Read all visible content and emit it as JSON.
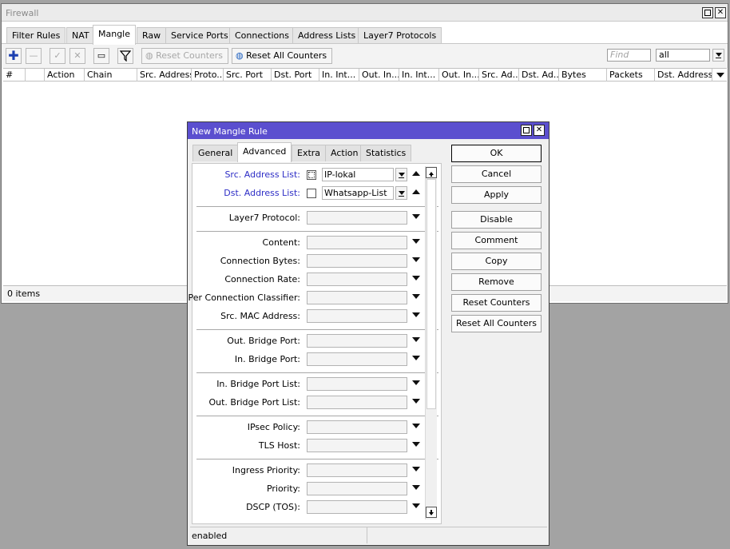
{
  "firewall": {
    "title": "Firewall",
    "tabs": [
      "Filter Rules",
      "NAT",
      "Mangle",
      "Raw",
      "Service Ports",
      "Connections",
      "Address Lists",
      "Layer7 Protocols"
    ],
    "active_tab": "Mangle",
    "toolbar": {
      "reset_counters": "Reset Counters",
      "reset_all_counters": "Reset All Counters",
      "find_placeholder": "Find",
      "filter_value": "all"
    },
    "columns": [
      "#",
      "",
      "Action",
      "Chain",
      "Src. Address",
      "Proto...",
      "Src. Port",
      "Dst. Port",
      "In. Int...",
      "Out. In...",
      "In. Int...",
      "Out. In...",
      "Src. Ad...",
      "Dst. Ad...",
      "Bytes",
      "Packets",
      "Dst. Address"
    ],
    "status": "0 items"
  },
  "dialog": {
    "title": "New Mangle Rule",
    "tabs": [
      "General",
      "Advanced",
      "Extra",
      "Action",
      "Statistics"
    ],
    "active_tab": "Advanced",
    "fields": {
      "src_address_list": {
        "label": "Src. Address List:",
        "value": "IP-lokal"
      },
      "dst_address_list": {
        "label": "Dst. Address List:",
        "value": "Whatsapp-List"
      },
      "layer7_protocol": "Layer7 Protocol:",
      "content": "Content:",
      "connection_bytes": "Connection Bytes:",
      "connection_rate": "Connection Rate:",
      "per_connection_classifier": "Per Connection Classifier:",
      "src_mac_address": "Src. MAC Address:",
      "out_bridge_port": "Out. Bridge Port:",
      "in_bridge_port": "In. Bridge Port:",
      "in_bridge_port_list": "In. Bridge Port List:",
      "out_bridge_port_list": "Out. Bridge Port List:",
      "ipsec_policy": "IPsec Policy:",
      "tls_host": "TLS Host:",
      "ingress_priority": "Ingress Priority:",
      "priority": "Priority:",
      "dscp_tos": "DSCP (TOS):"
    },
    "buttons": [
      "OK",
      "Cancel",
      "Apply",
      "Disable",
      "Comment",
      "Copy",
      "Remove",
      "Reset Counters",
      "Reset All Counters"
    ],
    "status": "enabled"
  }
}
